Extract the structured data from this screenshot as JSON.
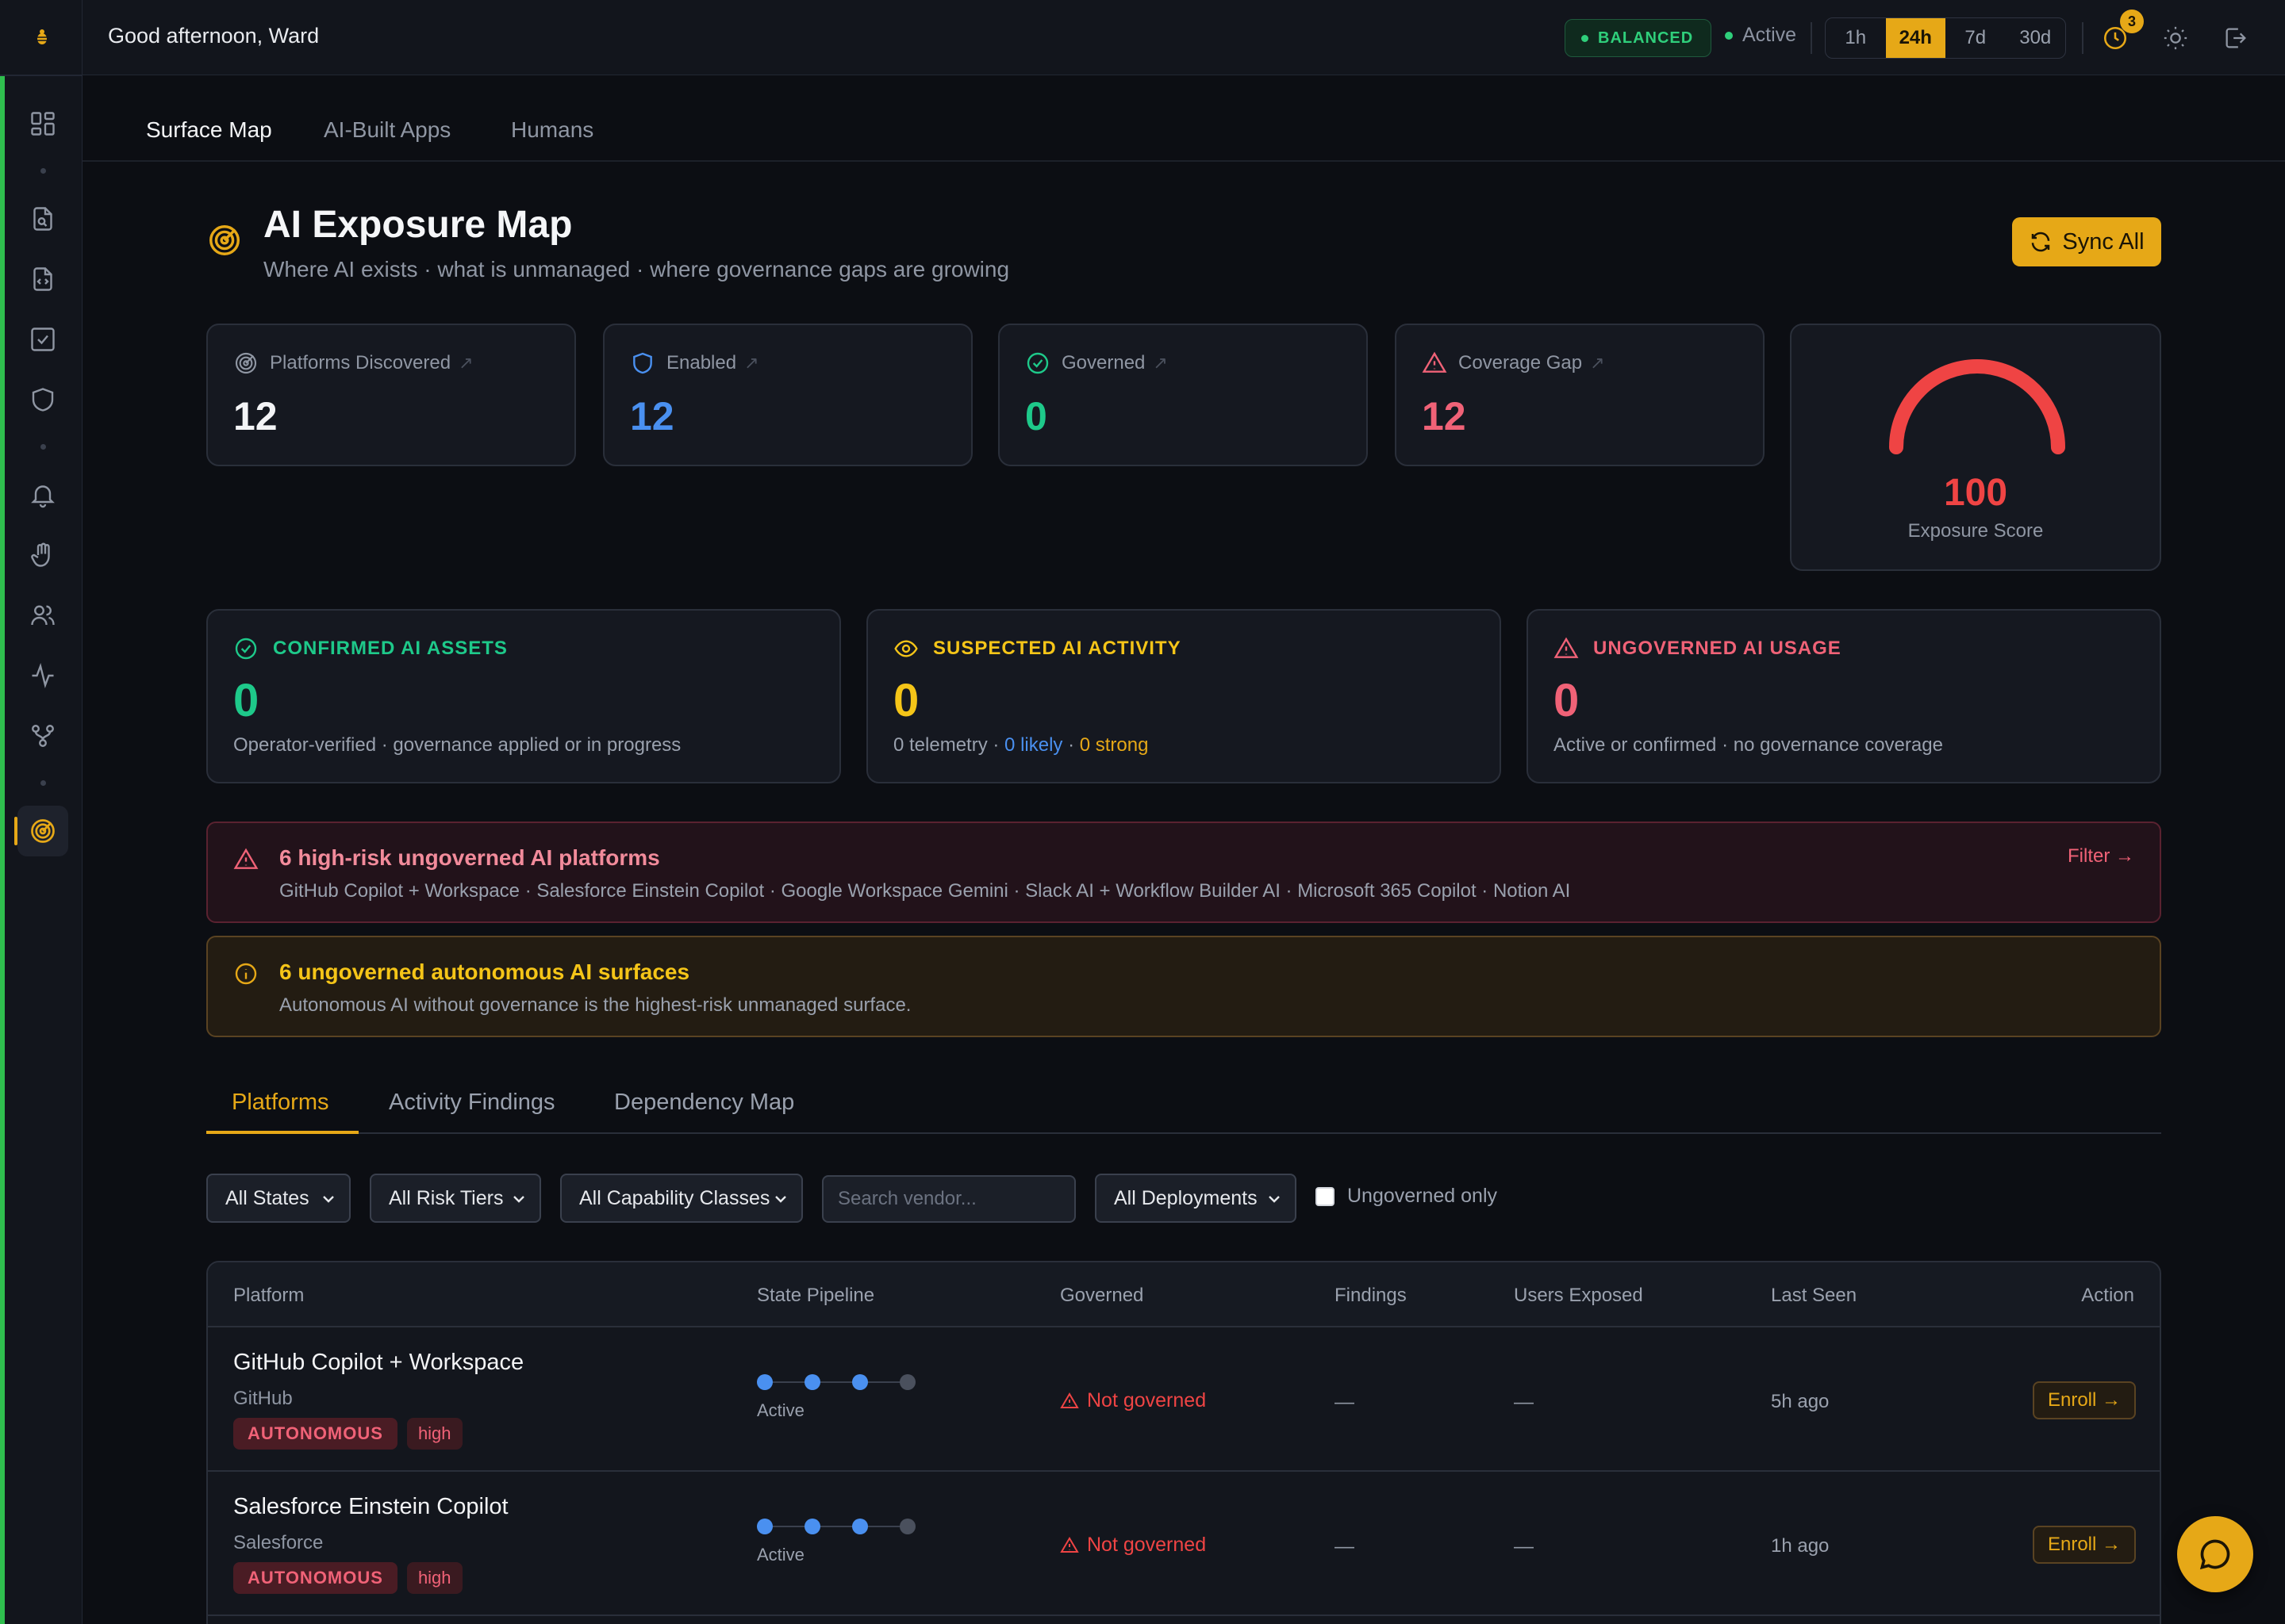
{
  "topbar": {
    "greeting": "Good afternoon, Ward",
    "mode_badge": "BALANCED",
    "status": "Active",
    "time_ranges": [
      "1h",
      "24h",
      "7d",
      "30d"
    ],
    "selected_range": "24h",
    "notification_count": "3"
  },
  "top_tabs": [
    "Surface Map",
    "AI-Built Apps",
    "Humans"
  ],
  "header": {
    "title": "AI Exposure Map",
    "subtitle": "Where AI exists · what is unmanaged · where governance gaps are growing",
    "sync_label": "Sync All"
  },
  "stats": [
    {
      "label": "Platforms Discovered",
      "value": "12",
      "color": "#f3f4f6"
    },
    {
      "label": "Enabled",
      "value": "12",
      "color": "#4a90f0"
    },
    {
      "label": "Governed",
      "value": "0",
      "color": "#1ec98a"
    },
    {
      "label": "Coverage Gap",
      "value": "12",
      "color": "#f06277"
    }
  ],
  "gauge": {
    "score": "100",
    "label": "Exposure Score",
    "fraction": 1.0,
    "color": "#ef4444"
  },
  "classification": [
    {
      "title": "CONFIRMED AI ASSETS",
      "value": "0",
      "desc": "Operator-verified · governance applied or in progress",
      "color": "#1ec98a"
    },
    {
      "title": "SUSPECTED AI ACTIVITY",
      "value": "0",
      "desc_prefix": "0 telemetry · ",
      "desc_likely": "0 likely",
      "desc_sep": " · ",
      "desc_strong": "0 strong",
      "color": "#f5c518"
    },
    {
      "title": "UNGOVERNED AI USAGE",
      "value": "0",
      "desc": "Active or confirmed · no governance coverage",
      "color": "#f06277"
    }
  ],
  "alerts": {
    "red": {
      "title": "6 high-risk ungoverned AI platforms",
      "desc": "GitHub Copilot + Workspace · Salesforce Einstein Copilot · Google Workspace Gemini · Slack AI + Workflow Builder AI · Microsoft 365 Copilot · Notion AI",
      "link": "Filter →"
    },
    "amber": {
      "title": "6 ungoverned autonomous AI surfaces",
      "desc": "Autonomous AI without governance is the highest-risk unmanaged surface."
    }
  },
  "section_tabs": [
    "Platforms",
    "Activity Findings",
    "Dependency Map"
  ],
  "filters": {
    "states": "All States",
    "risk_tiers": "All Risk Tiers",
    "capability": "All Capability Classes",
    "search_placeholder": "Search vendor...",
    "deployments": "All Deployments",
    "ungoverned_only": "Ungoverned only"
  },
  "table": {
    "columns": [
      "Platform",
      "State Pipeline",
      "Governed",
      "Findings",
      "Users Exposed",
      "Last Seen",
      "Action"
    ],
    "rows": [
      {
        "name": "GitHub Copilot + Workspace",
        "vendor": "GitHub",
        "tag": "AUTONOMOUS",
        "risk": "high",
        "state": "Active",
        "governed": "Not governed",
        "findings": "—",
        "users": "—",
        "last_seen": "5h ago",
        "action": "Enroll →"
      },
      {
        "name": "Salesforce Einstein Copilot",
        "vendor": "Salesforce",
        "tag": "AUTONOMOUS",
        "risk": "high",
        "state": "Active",
        "governed": "Not governed",
        "findings": "—",
        "users": "—",
        "last_seen": "1h ago",
        "action": "Enroll →"
      }
    ]
  }
}
